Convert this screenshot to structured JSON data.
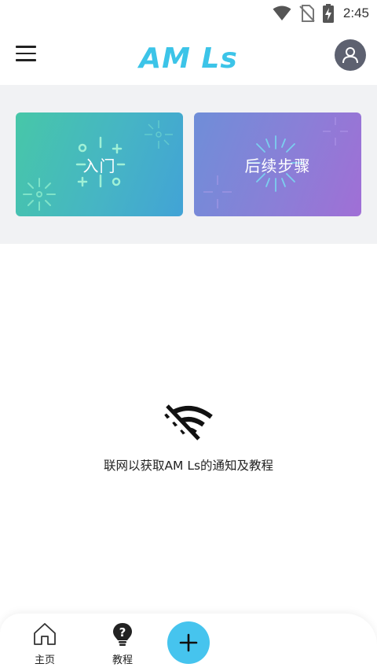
{
  "status_bar": {
    "time": "2:45",
    "icons": [
      "wifi-icon",
      "no-sim-icon",
      "battery-charging-icon"
    ]
  },
  "app_bar": {
    "logo_text": "AM Ls",
    "menu_icon": "hamburger-menu-icon",
    "account_icon": "user-avatar-icon"
  },
  "cards": [
    {
      "label": "入门",
      "gradient": [
        "#47c7a8",
        "#42a3d6"
      ]
    },
    {
      "label": "后续步骤",
      "gradient": [
        "#6f8ed8",
        "#a06fd6"
      ]
    }
  ],
  "offline": {
    "icon": "wifi-off-icon",
    "message": "联网以获取AM Ls的通知及教程"
  },
  "bottom_nav": {
    "items": [
      {
        "label": "主页",
        "icon": "home-icon"
      },
      {
        "label": "教程",
        "icon": "help-bulb-icon"
      }
    ],
    "fab_icon": "plus-icon",
    "fab_color": "#46c4ee"
  },
  "colors": {
    "logo": "#3cc4e8",
    "cards_background": "#f1f2f4",
    "avatar": "#5d6170"
  }
}
